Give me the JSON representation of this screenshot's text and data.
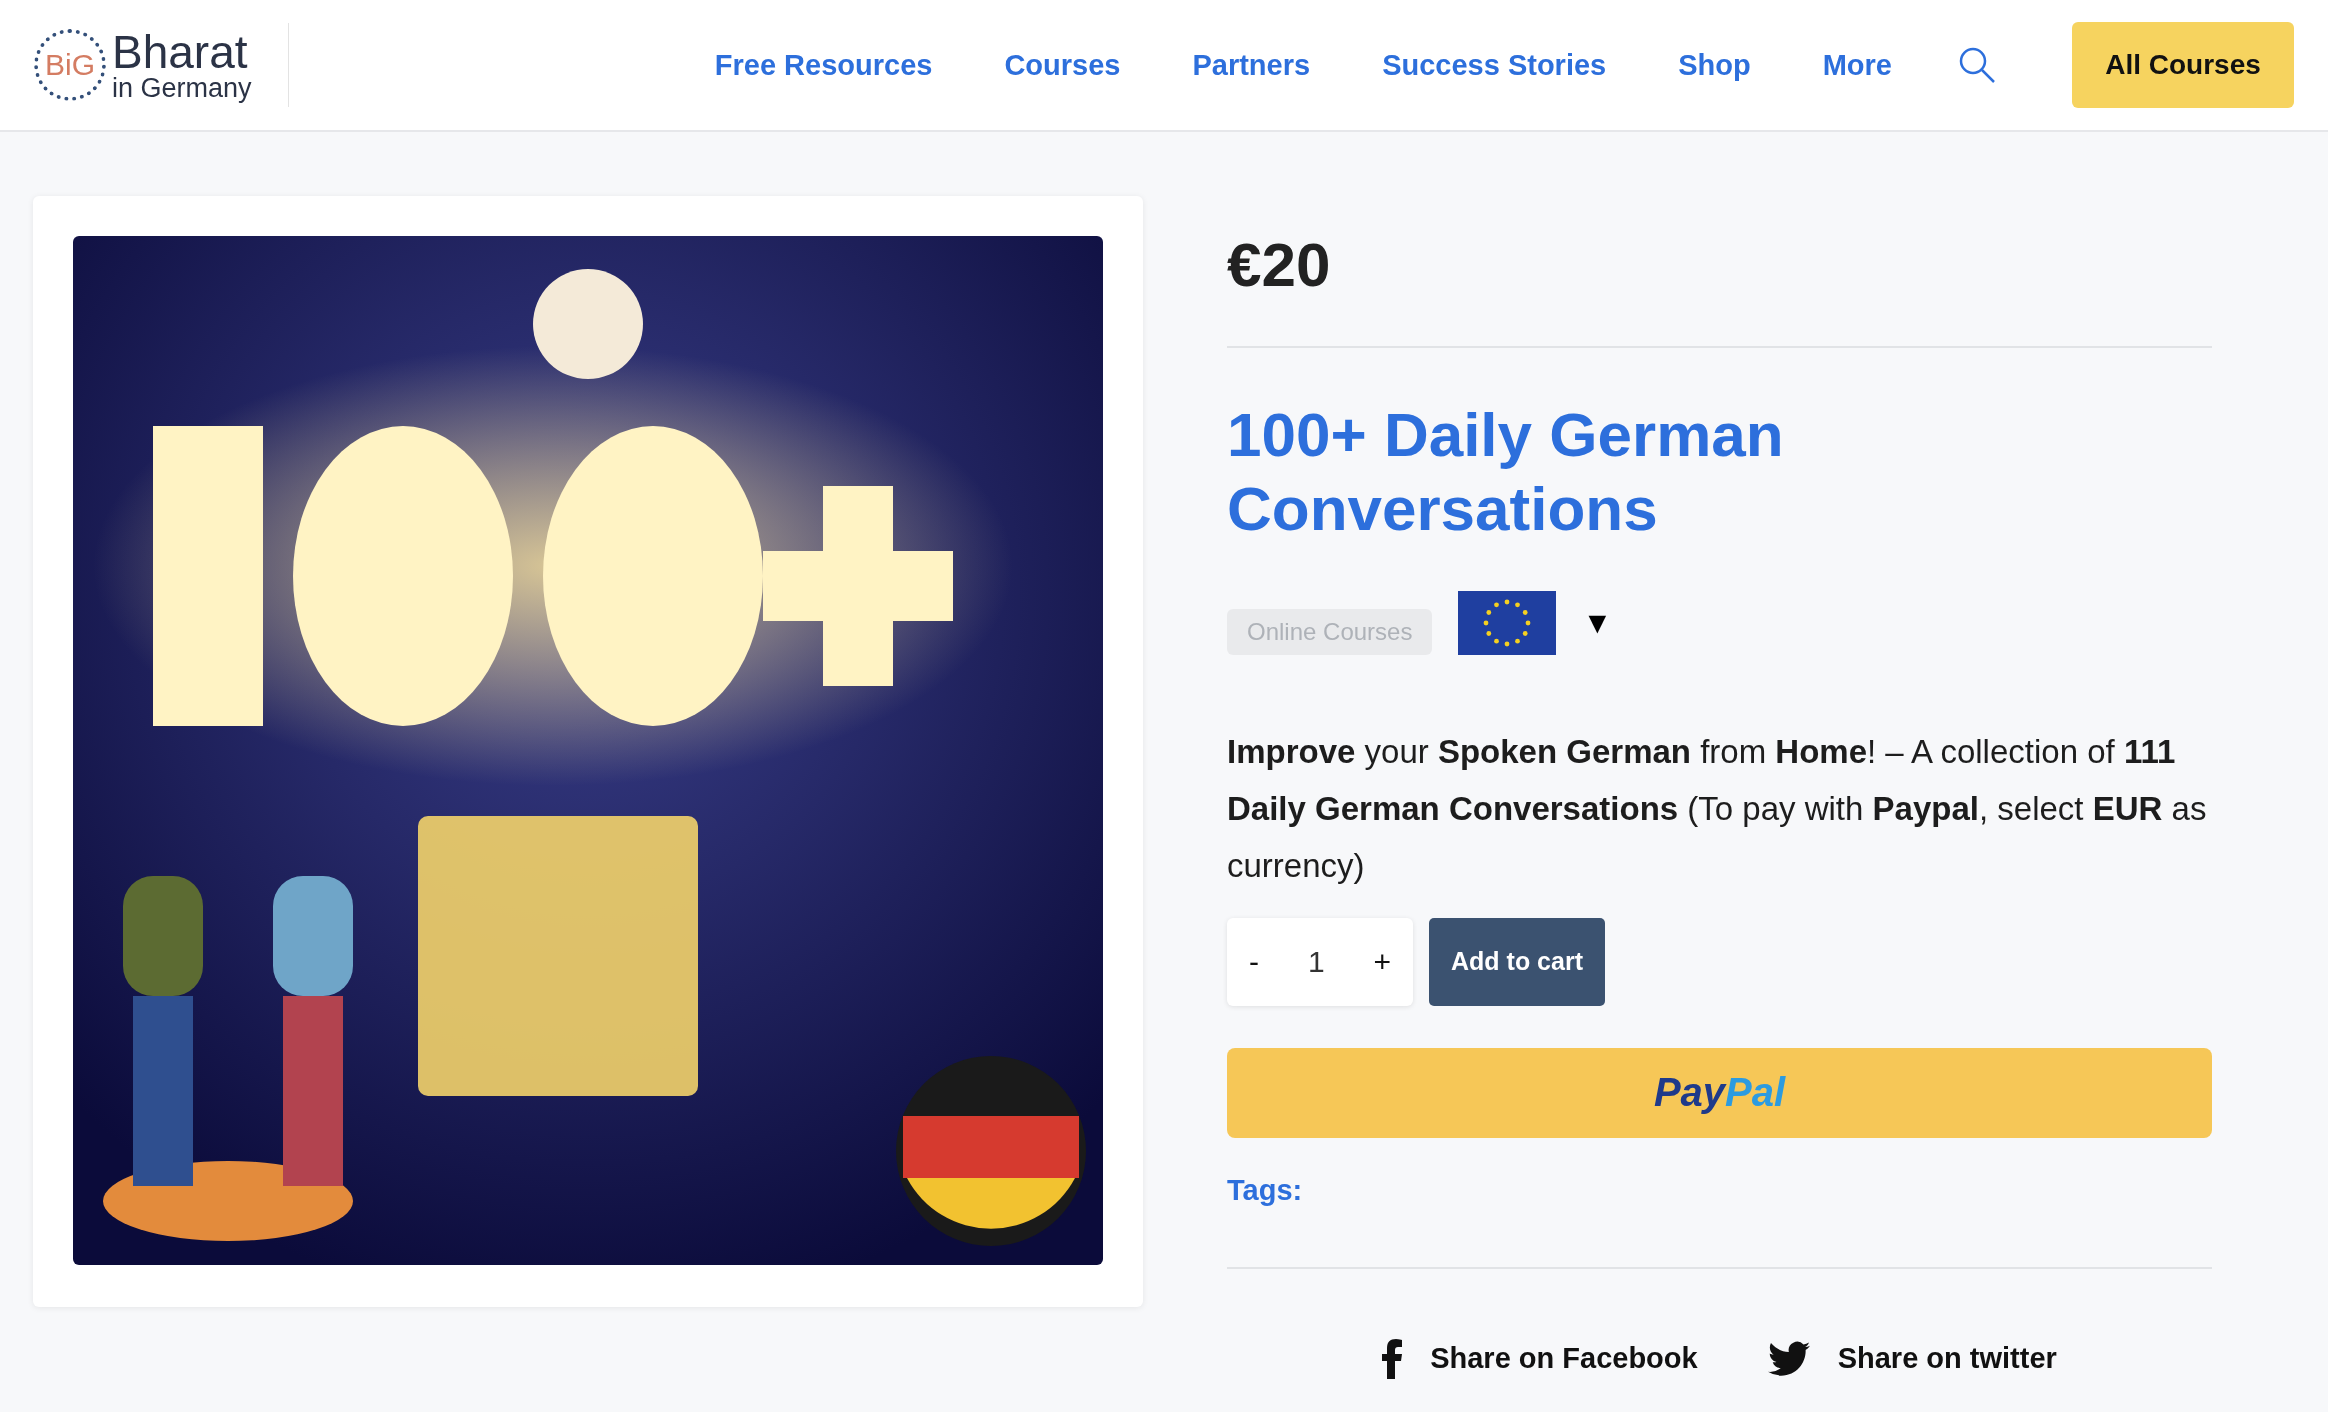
{
  "header": {
    "logo": {
      "mark": "BiG",
      "name": "Bharat",
      "subtitle": "in Germany"
    },
    "nav": [
      {
        "label": "Free Resources"
      },
      {
        "label": "Courses"
      },
      {
        "label": "Partners"
      },
      {
        "label": "Success Stories"
      },
      {
        "label": "Shop"
      },
      {
        "label": "More"
      }
    ],
    "cta": "All Courses"
  },
  "product": {
    "price": "€20",
    "title": "100+ Daily German Conversations",
    "category": "Online Courses",
    "currency_selector": {
      "arrow": "▼"
    },
    "description": "**Improve** your **Spoken German** from **Home**! – A collection of **111 Daily German Conversations** (To pay with **Paypal**, select **EUR** as currency)",
    "quantity": {
      "minus": "-",
      "value": "1",
      "plus": "+"
    },
    "add_to_cart": "Add to cart",
    "paypal_button": [
      "Pay",
      "Pal"
    ],
    "tags_label": "Tags:",
    "share": [
      {
        "kind": "facebook",
        "label": "Share on Facebook"
      },
      {
        "kind": "twitter",
        "label": "Share on twitter"
      }
    ]
  }
}
